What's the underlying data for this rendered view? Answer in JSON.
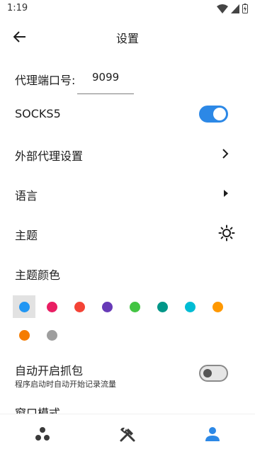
{
  "status_bar": {
    "time": "1:19"
  },
  "header": {
    "title": "设置"
  },
  "settings": {
    "proxy_port_label": "代理端口号:",
    "proxy_port_value": "9099",
    "socks5_label": "SOCKS5",
    "socks5_enabled": true,
    "external_proxy_label": "外部代理设置",
    "language_label": "语言",
    "theme_label": "主题",
    "theme_color_label": "主题颜色",
    "auto_capture_label": "自动开启抓包",
    "auto_capture_desc": "程序启动时自动开始记录流量",
    "auto_capture_enabled": false,
    "window_mode_label": "窗口模式"
  },
  "theme_colors": [
    {
      "color": "#2196f3",
      "selected": true
    },
    {
      "color": "#e91e63",
      "selected": false
    },
    {
      "color": "#f44336",
      "selected": false
    },
    {
      "color": "#673ab7",
      "selected": false
    },
    {
      "color": "#43c443",
      "selected": false
    },
    {
      "color": "#009688",
      "selected": false
    },
    {
      "color": "#00bcd4",
      "selected": false
    },
    {
      "color": "#ff9800",
      "selected": false
    },
    {
      "color": "#f57c00",
      "selected": false
    },
    {
      "color": "#9e9e9e",
      "selected": false
    }
  ],
  "bottom_nav": {
    "items": [
      {
        "icon": "dots-cluster-icon",
        "active": false
      },
      {
        "icon": "tools-icon",
        "active": false
      },
      {
        "icon": "person-icon",
        "active": true
      }
    ],
    "active_color": "#2c88e6",
    "inactive_color": "#3a3a3a"
  },
  "accent_color": "#2c88e6"
}
